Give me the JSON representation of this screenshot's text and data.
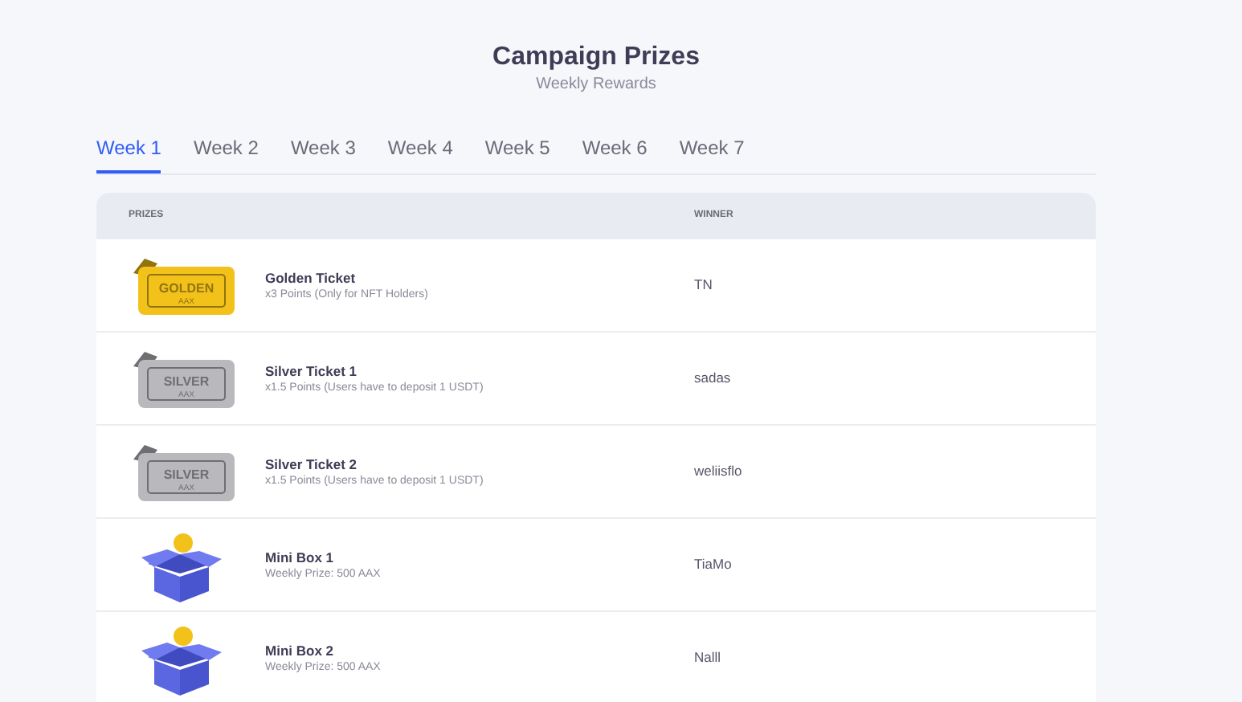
{
  "header": {
    "title": "Campaign Prizes",
    "subtitle": "Weekly Rewards"
  },
  "tabs": [
    {
      "label": "Week 1",
      "selected": true
    },
    {
      "label": "Week 2",
      "selected": false
    },
    {
      "label": "Week 3",
      "selected": false
    },
    {
      "label": "Week 4",
      "selected": false
    },
    {
      "label": "Week 5",
      "selected": false
    },
    {
      "label": "Week 6",
      "selected": false
    },
    {
      "label": "Week 7",
      "selected": false
    }
  ],
  "table": {
    "columns": [
      "PRIZES",
      "WINNER"
    ],
    "rows": [
      {
        "kind": "ticket",
        "color": "#f2c21b",
        "ticket_label": "GOLDEN",
        "ticket_sublabel": "AAX",
        "name": "Golden Ticket",
        "description": "x3 Points (Only for NFT Holders)",
        "winner": "TN"
      },
      {
        "kind": "ticket",
        "color": "#b9b9bd",
        "ticket_label": "SILVER",
        "ticket_sublabel": "AAX",
        "name": "Silver Ticket 1",
        "description": "x1.5 Points (Users have to deposit 1 USDT)",
        "winner": "sadas"
      },
      {
        "kind": "ticket",
        "color": "#b9b9bd",
        "ticket_label": "SILVER",
        "ticket_sublabel": "AAX",
        "name": "Silver Ticket 2",
        "description": "x1.5 Points (Users have to deposit 1 USDT)",
        "winner": "weliisflo"
      },
      {
        "kind": "box",
        "name": "Mini Box 1",
        "description": "Weekly Prize: 500 AAX",
        "winner": "TiaMo"
      },
      {
        "kind": "box",
        "name": "Mini Box 2",
        "description": "Weekly Prize: 500 AAX",
        "winner": "Nalll"
      }
    ]
  }
}
